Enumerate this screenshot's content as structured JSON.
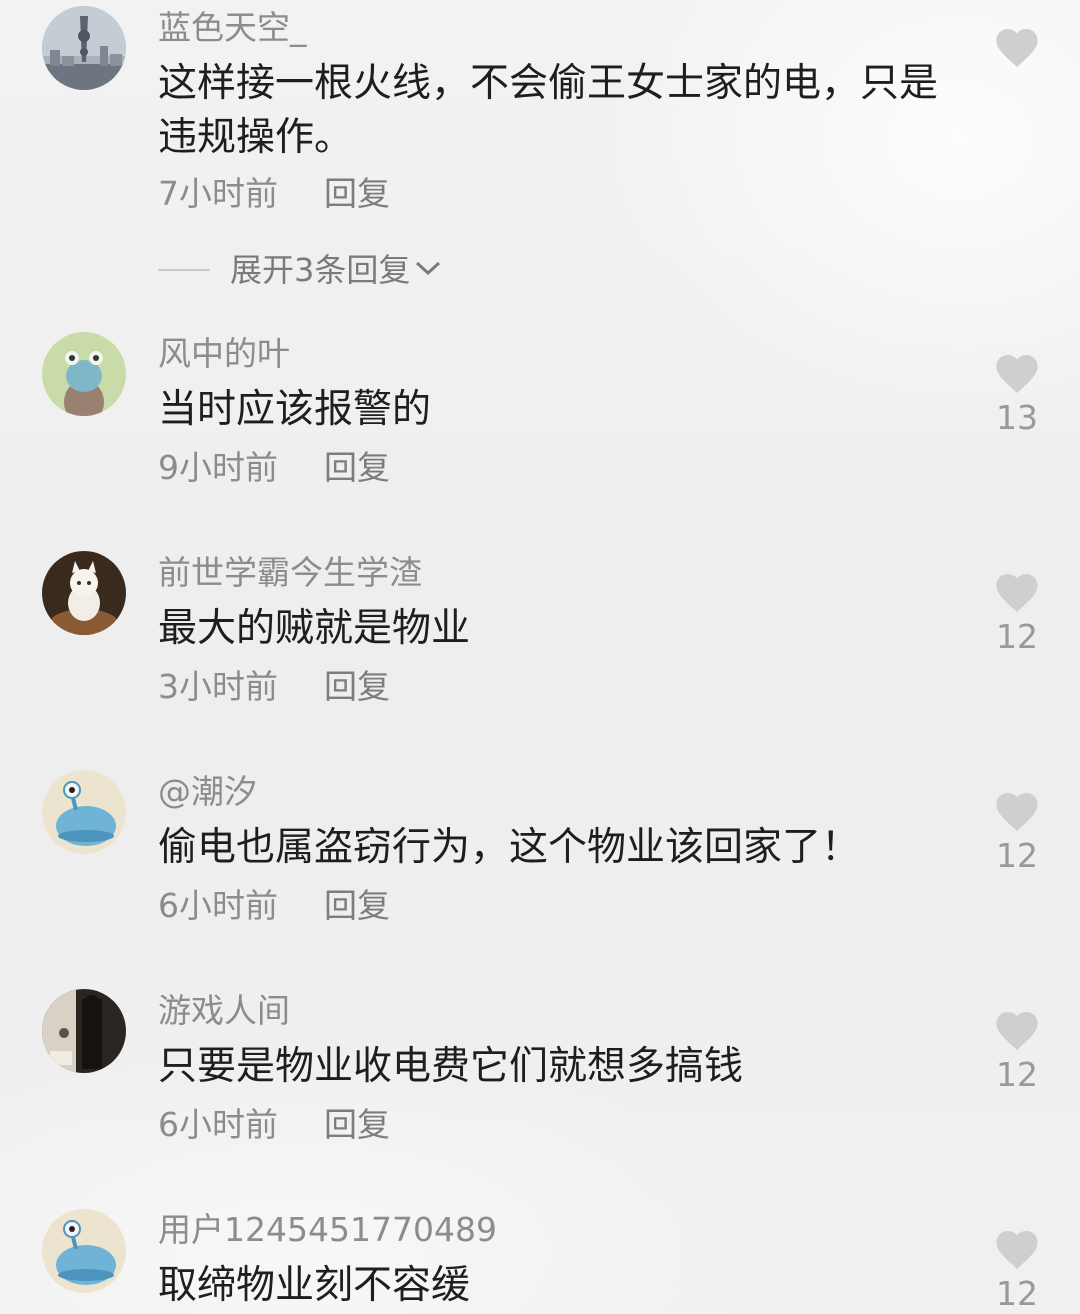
{
  "comments": [
    {
      "username": "蓝色天空_",
      "text": "这样接一根火线，不会偷王女士家的电，只是违规操作。",
      "time": "7小时前",
      "reply": "回复",
      "likes": ""
    },
    {
      "username": "风中的叶",
      "text": "当时应该报警的",
      "time": "9小时前",
      "reply": "回复",
      "likes": "13"
    },
    {
      "username": "前世学霸今生学渣",
      "text": "最大的贼就是物业",
      "time": "3小时前",
      "reply": "回复",
      "likes": "12"
    },
    {
      "username": "@潮汐",
      "text": "偷电也属盗窃行为，这个物业该回家了！",
      "time": "6小时前",
      "reply": "回复",
      "likes": "12"
    },
    {
      "username": "游戏人间",
      "text": "只要是物业收电费它们就想多搞钱",
      "time": "6小时前",
      "reply": "回复",
      "likes": "12"
    },
    {
      "username": "用户1245451770489",
      "text": "取缔物业刻不容缓",
      "time": "",
      "reply": "",
      "likes": "12"
    }
  ],
  "expand_replies": "展开3条回复",
  "icons": {
    "like": "heart-icon",
    "expand": "chevron-down-icon"
  },
  "colors": {
    "username": "#8c8c8c",
    "text": "#1e1e1e",
    "heart": "#cfcfcf"
  }
}
